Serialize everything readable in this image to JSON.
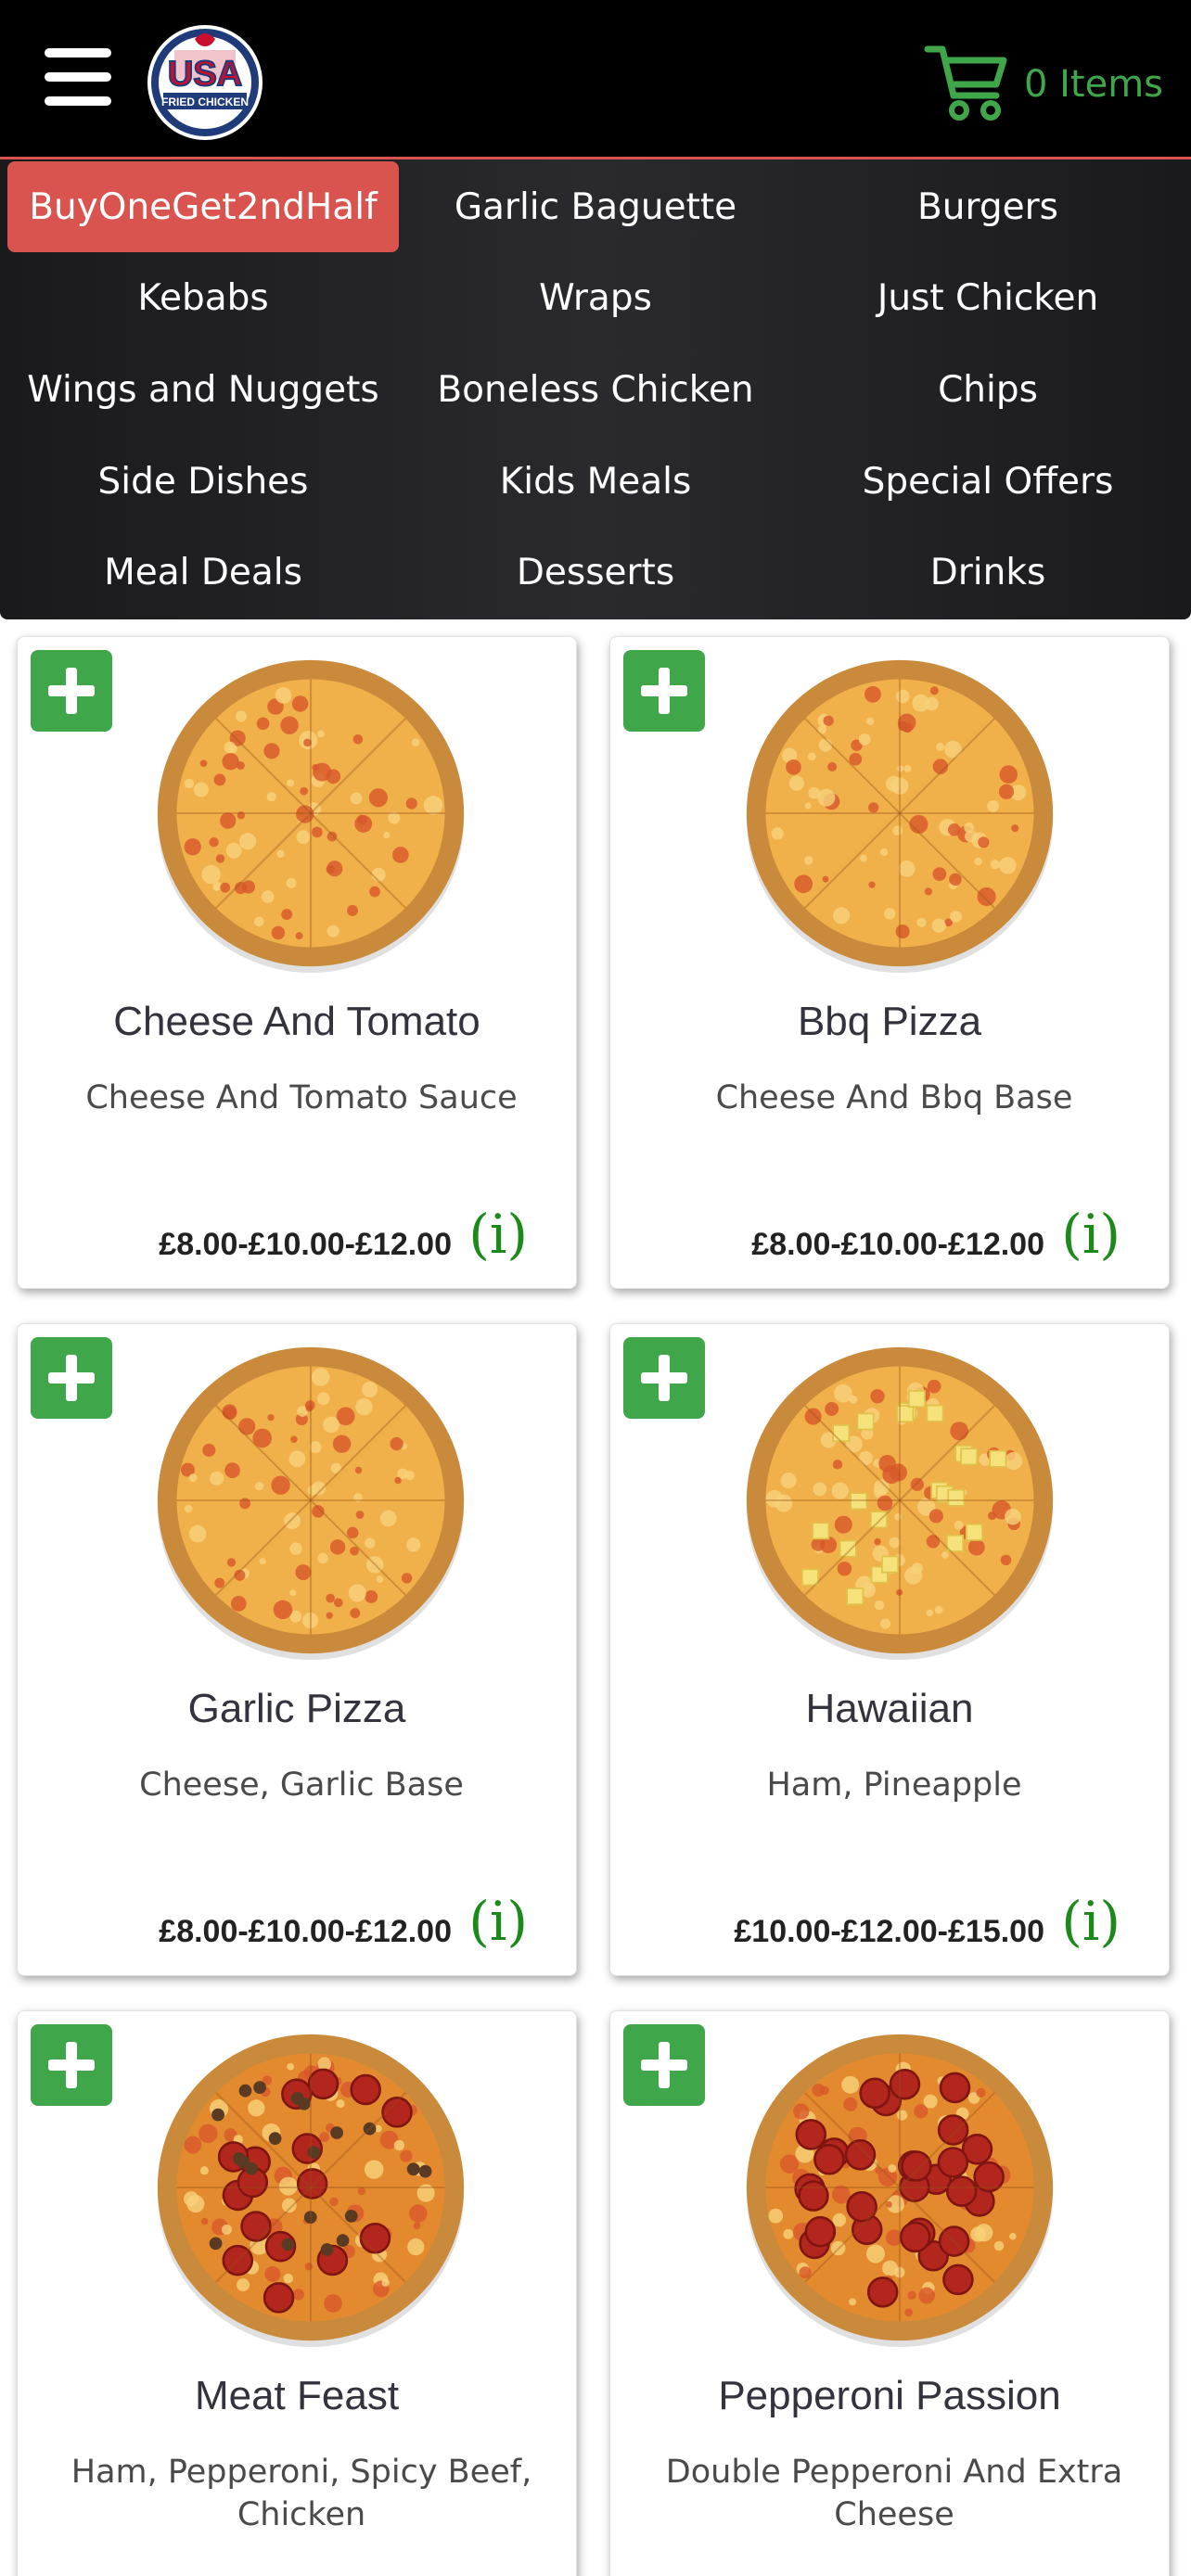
{
  "header": {
    "logo_text_top": "USA",
    "logo_text_bottom": "FRIED CHICKEN",
    "cart_label": "0 Items"
  },
  "categories": [
    "BuyOneGet2ndHalf",
    "Garlic Baguette",
    "Burgers",
    "Kebabs",
    "Wraps",
    "Just Chicken",
    "Wings and Nuggets",
    "Boneless Chicken",
    "Chips",
    "Side Dishes",
    "Kids Meals",
    "Special Offers",
    "Meal Deals",
    "Desserts",
    "Drinks"
  ],
  "active_category": "BuyOneGet2ndHalf",
  "products": [
    {
      "name": "Cheese And Tomato",
      "description": "Cheese And Tomato Sauce",
      "price": "£8.00-£10.00-£12.00",
      "info": "(i)",
      "topping": "cheese"
    },
    {
      "name": "Bbq Pizza",
      "description": "Cheese And Bbq Base",
      "price": "£8.00-£10.00-£12.00",
      "info": "(i)",
      "topping": "cheese"
    },
    {
      "name": "Garlic Pizza",
      "description": "Cheese, Garlic Base",
      "price": "£8.00-£10.00-£12.00",
      "info": "(i)",
      "topping": "cheese"
    },
    {
      "name": "Hawaiian",
      "description": "Ham, Pineapple",
      "price": "£10.00-£12.00-£15.00",
      "info": "(i)",
      "topping": "hawaiian"
    },
    {
      "name": "Meat Feast",
      "description": "Ham, Pepperoni, Spicy Beef, Chicken",
      "price": "",
      "info": "",
      "topping": "meat"
    },
    {
      "name": "Pepperoni Passion",
      "description": "Double Pepperoni And Extra Cheese",
      "price": "",
      "info": "",
      "topping": "pepperoni"
    }
  ],
  "colors": {
    "brand_red": "#d9534f",
    "accent_green": "#3fa64a",
    "info_green": "#1b8a1b",
    "header_bg": "#000000"
  },
  "icons": [
    "menu-icon",
    "cart-icon",
    "plus-icon",
    "info-icon"
  ]
}
